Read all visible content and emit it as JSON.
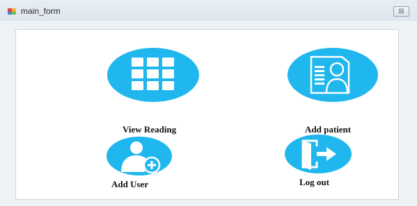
{
  "window": {
    "title": "main_form",
    "close_symbol": "⊠"
  },
  "colors": {
    "accent": "#1fb7ee",
    "icon_white": "#ffffff"
  },
  "tiles": {
    "view_reading": {
      "label": "View Reading",
      "icon": "grid-icon"
    },
    "add_patient": {
      "label": "Add  patient",
      "icon": "patient-record-icon"
    },
    "add_user": {
      "label": "Add User",
      "icon": "add-user-icon"
    },
    "log_out": {
      "label": "Log out",
      "icon": "logout-door-icon"
    }
  }
}
